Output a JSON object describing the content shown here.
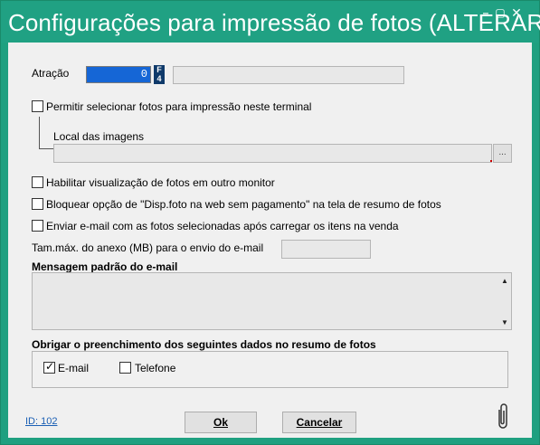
{
  "window": {
    "title": "Configurações para impressão de fotos (ALTERAR)",
    "controls": {
      "minimize": "–",
      "maximize": "▢",
      "close": "✕"
    }
  },
  "attraction": {
    "label": "Atração",
    "code_value": "0",
    "lookup_key": "F4",
    "description_value": ""
  },
  "allow_selection": {
    "label": "Permitir selecionar fotos para impressão neste terminal",
    "checked": false
  },
  "images_location": {
    "label": "Local das imagens",
    "value": "",
    "browse_label": "..."
  },
  "options": [
    {
      "label": "Habilitar visualização de fotos em outro monitor",
      "checked": false
    },
    {
      "label": "Bloquear opção de \"Disp.foto na web sem pagamento\" na tela de resumo de fotos",
      "checked": false
    },
    {
      "label": "Enviar e-mail com as fotos selecionadas após carregar os itens na venda",
      "checked": false
    }
  ],
  "attachment_size": {
    "label": "Tam.máx. do anexo (MB) para o envio do e-mail",
    "value": ""
  },
  "default_message": {
    "label": "Mensagem padrão do e-mail",
    "value": "",
    "scroll_up": "▲",
    "scroll_down": "▼"
  },
  "required_fields": {
    "label": "Obrigar o preenchimento dos seguintes dados no resumo de fotos",
    "items": [
      {
        "label": "E-mail",
        "checked": true
      },
      {
        "label": "Telefone",
        "checked": false
      }
    ]
  },
  "footer": {
    "id_label": "ID: 102",
    "ok_label": "Ok",
    "cancel_label": "Cancelar"
  },
  "colors": {
    "titlebar": "#20a183",
    "selection": "#1566d6",
    "link": "#1a5fb4"
  },
  "icons": {
    "attachment": "paperclip-icon"
  }
}
